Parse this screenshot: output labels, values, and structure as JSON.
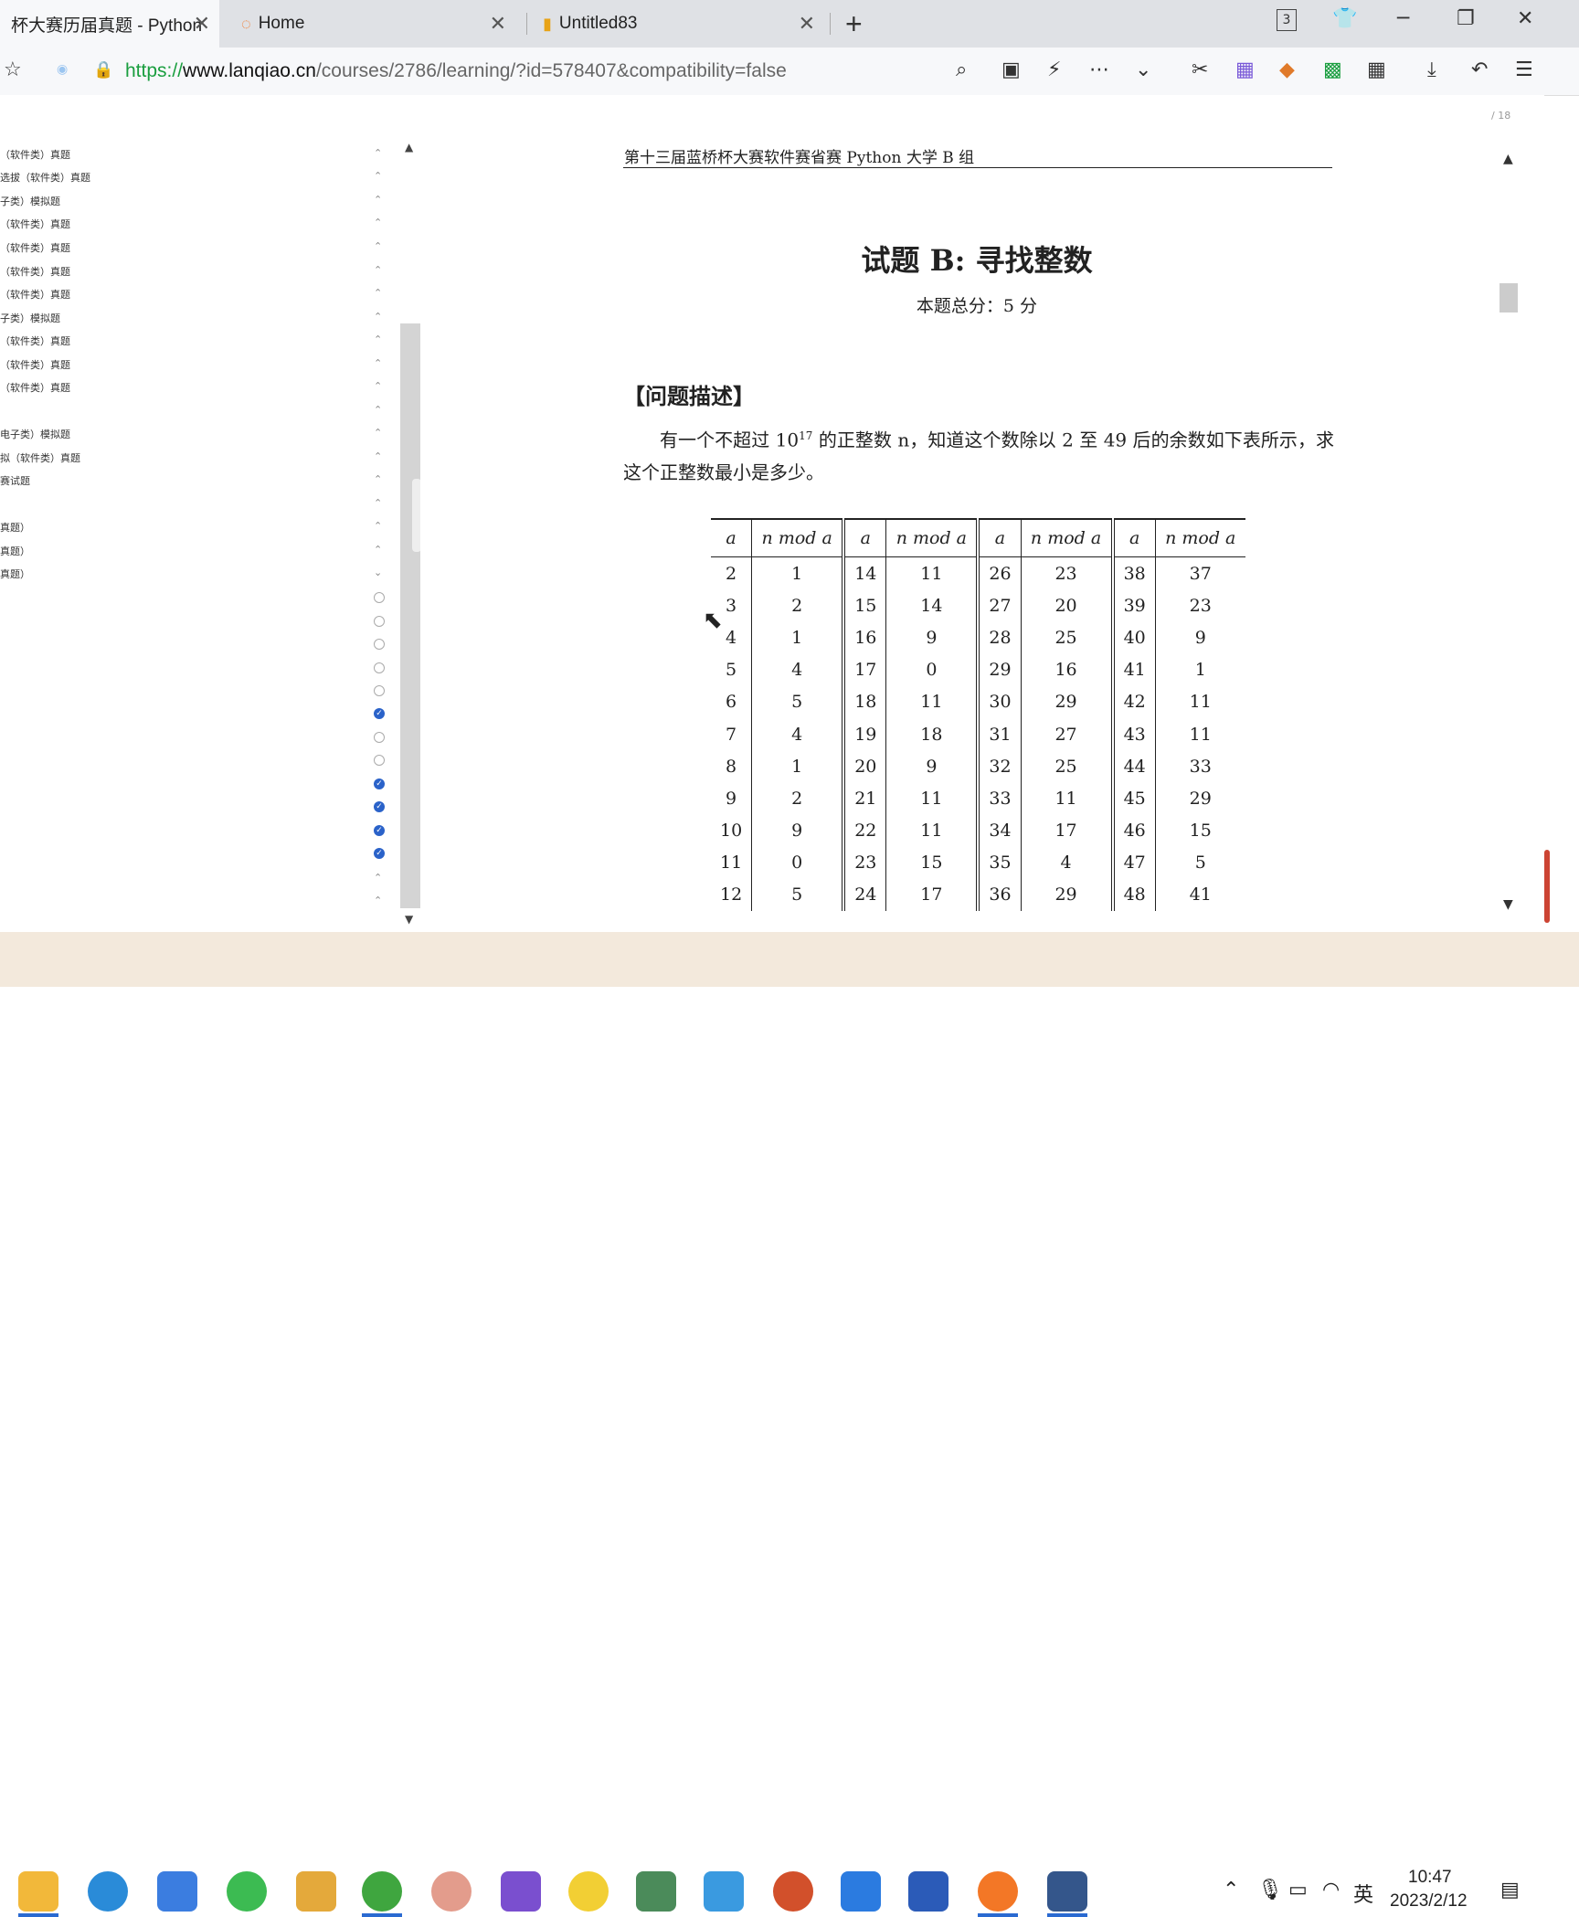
{
  "tabs": [
    {
      "label": "杯大赛历届真题 - Python",
      "active": true
    },
    {
      "label": "Home",
      "active": false
    },
    {
      "label": "Untitled83",
      "active": false
    }
  ],
  "tab_count_badge": "3",
  "address": {
    "scheme": "https://",
    "host": "www.lanqiao.cn",
    "path": "/courses/2786/learning/?id=578407&compatibility=false"
  },
  "sidebar": {
    "items": [
      "（软件类）真题",
      "选拔（软件类）真题",
      "子类）模拟题",
      "（软件类）真题",
      "（软件类）真题",
      "（软件类）真题",
      "（软件类）真题",
      "子类）模拟题",
      "（软件类）真题",
      "（软件类）真题",
      "（软件类）真题",
      "",
      "电子类）模拟题",
      "拟（软件类）真题",
      "赛试题",
      "",
      "真题）",
      "真题）",
      "真题）"
    ]
  },
  "document": {
    "header": "第十三届蓝桥杯大赛软件赛省赛 Python 大学 B 组",
    "title": "试题 B: 寻找整数",
    "score": "本题总分：5 分",
    "section": "【问题描述】",
    "para_before": "有一个不超过 10",
    "para_sup": "17",
    "para_after": " 的正整数 n，知道这个数除以 2 至 49 后的余数如下表所示，求这个正整数最小是多少。",
    "page_counter": "/ 18",
    "table": {
      "headers": [
        "a",
        "n mod a",
        "a",
        "n mod a",
        "a",
        "n mod a",
        "a",
        "n mod a"
      ],
      "rows": [
        [
          "2",
          "1",
          "14",
          "11",
          "26",
          "23",
          "38",
          "37"
        ],
        [
          "3",
          "2",
          "15",
          "14",
          "27",
          "20",
          "39",
          "23"
        ],
        [
          "4",
          "1",
          "16",
          "9",
          "28",
          "25",
          "40",
          "9"
        ],
        [
          "5",
          "4",
          "17",
          "0",
          "29",
          "16",
          "41",
          "1"
        ],
        [
          "6",
          "5",
          "18",
          "11",
          "30",
          "29",
          "42",
          "11"
        ],
        [
          "7",
          "4",
          "19",
          "18",
          "31",
          "27",
          "43",
          "11"
        ],
        [
          "8",
          "1",
          "20",
          "9",
          "32",
          "25",
          "44",
          "33"
        ],
        [
          "9",
          "2",
          "21",
          "11",
          "33",
          "11",
          "45",
          "29"
        ],
        [
          "10",
          "9",
          "22",
          "11",
          "34",
          "17",
          "46",
          "15"
        ],
        [
          "11",
          "0",
          "23",
          "15",
          "35",
          "4",
          "47",
          "5"
        ],
        [
          "12",
          "5",
          "24",
          "17",
          "36",
          "29",
          "48",
          "41"
        ]
      ]
    }
  },
  "taskbar": {
    "ime": "英",
    "time": "10:47",
    "date": "2023/2/12"
  }
}
